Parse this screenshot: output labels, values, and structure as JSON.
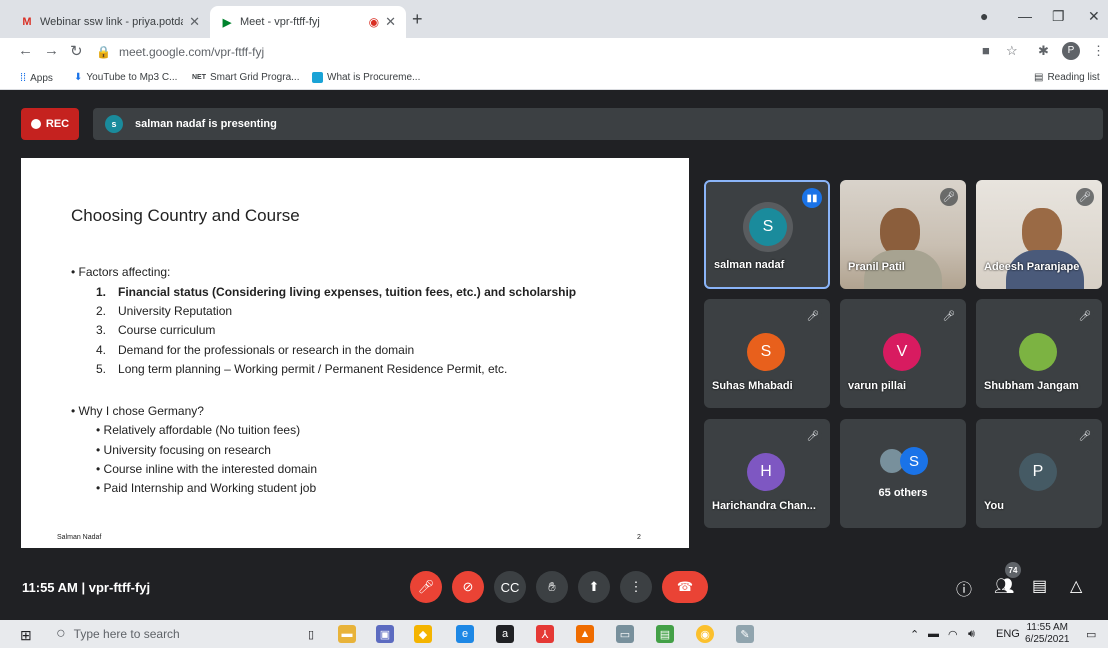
{
  "browser": {
    "tabs": [
      {
        "title": "Webinar ssw link - priya.potdar@",
        "icon": "gmail-icon"
      },
      {
        "title": "Meet - vpr-ftff-fyj",
        "icon": "meet-icon"
      }
    ],
    "url": "meet.google.com/vpr-ftff-fyj",
    "profile_initial": "P",
    "bookmarks": [
      {
        "label": "Apps"
      },
      {
        "label": "YouTube to Mp3 C..."
      },
      {
        "label": "Smart Grid Progra..."
      },
      {
        "label": "What is Procureme..."
      }
    ],
    "reading_list": "Reading list"
  },
  "meet": {
    "rec_label": "REC",
    "presenter_initial": "s",
    "presenting_text": "salman nadaf is presenting",
    "slide": {
      "title": "Choosing Country and Course",
      "bullet1": "Factors affecting:",
      "items": [
        {
          "num": "1.",
          "text": "Financial status (Considering living expenses, tuition fees, etc.) and scholarship"
        },
        {
          "num": "2.",
          "text": "University Reputation"
        },
        {
          "num": "3.",
          "text": "Course curriculum"
        },
        {
          "num": "4.",
          "text": "Demand for the professionals or research in the domain"
        },
        {
          "num": "5.",
          "text": "Long term planning – Working permit / Permanent Residence Permit, etc."
        }
      ],
      "bullet2": "Why I chose Germany?",
      "subitems": [
        "Relatively affordable (No tuition fees)",
        "University focusing on research",
        "Course inline with the interested domain",
        "Paid Internship and Working student job"
      ],
      "footer_name": "Salman Nadaf",
      "footer_page": "2"
    },
    "participants": [
      {
        "name": "salman nadaf",
        "initial": "S",
        "color": "#1a8b9c"
      },
      {
        "name": "Pranil Patil"
      },
      {
        "name": "Adeesh Paranjape"
      },
      {
        "name": "Suhas Mhabadi",
        "initial": "S",
        "color": "#e8601c"
      },
      {
        "name": "varun pillai",
        "initial": "V",
        "color": "#d81b60"
      },
      {
        "name": "Shubham Jangam"
      },
      {
        "name": "Harichandra Chan...",
        "initial": "H",
        "color": "#7e57c2"
      },
      {
        "name": "65 others",
        "initial": "S"
      },
      {
        "name": "You",
        "initial": "P",
        "color": "#455a64"
      }
    ],
    "meeting_time": "11:55 AM",
    "meeting_code": "vpr-ftff-fyj",
    "participant_count": "74"
  },
  "taskbar": {
    "search_placeholder": "Type here to search",
    "lang": "ENG",
    "time": "11:55 AM",
    "date": "6/25/2021"
  }
}
